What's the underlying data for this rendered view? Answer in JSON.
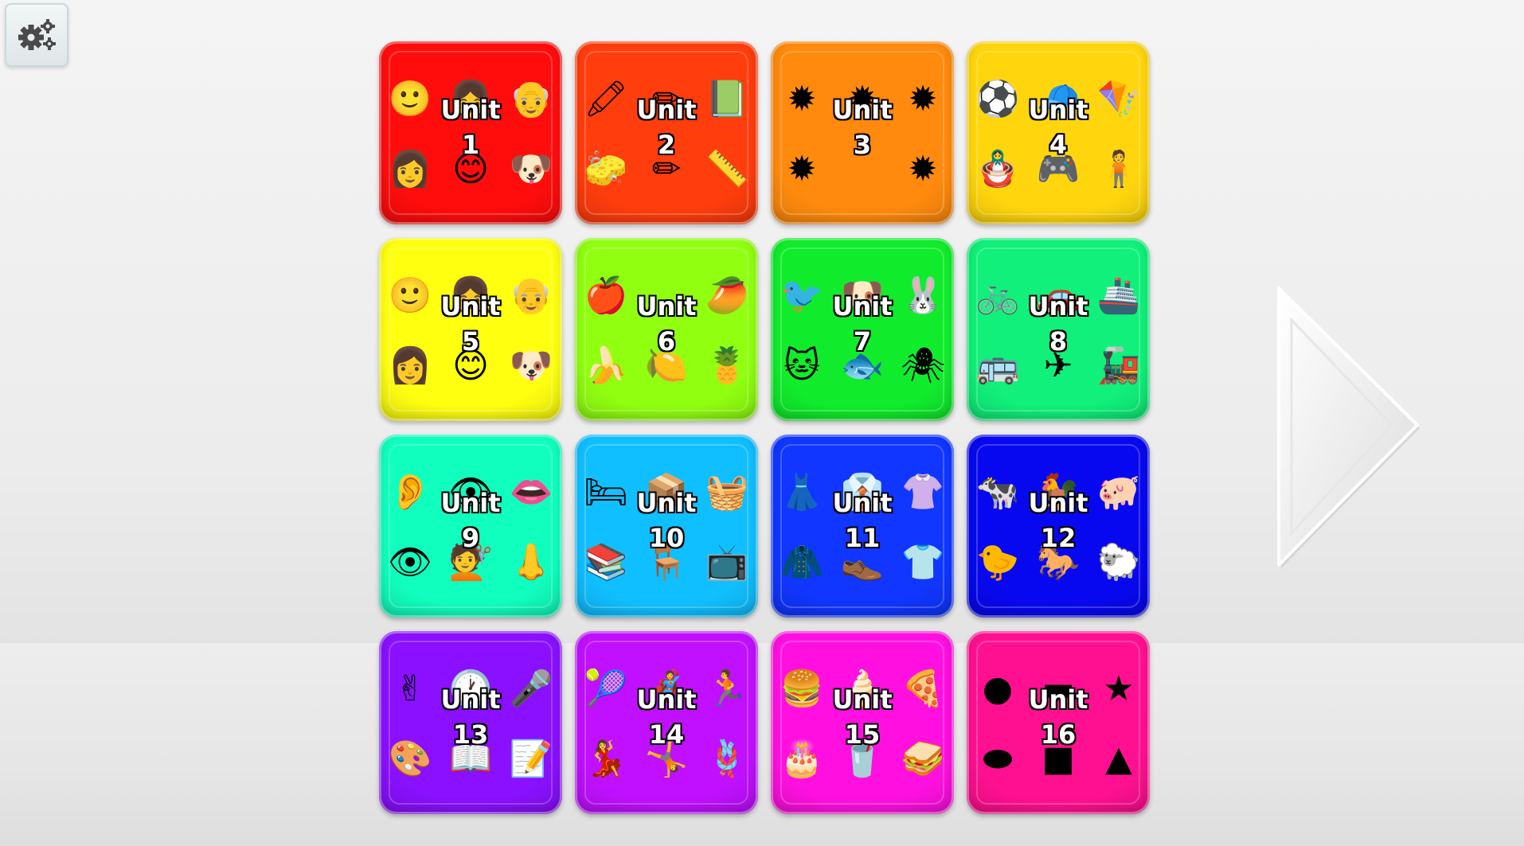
{
  "settings": {
    "icon": "gear-icon"
  },
  "next": {
    "icon": "next-arrow-icon"
  },
  "units": [
    {
      "title": "Unit",
      "number": "1",
      "color": "#ff0d0d",
      "icons": [
        "🙂",
        "👧",
        "👴",
        "👩",
        "😊",
        "🐶"
      ]
    },
    {
      "title": "Unit",
      "number": "2",
      "color": "#ff3d0d",
      "icons": [
        "🖍",
        "✏",
        "📗",
        "🧽",
        "✏",
        "📏"
      ]
    },
    {
      "title": "Unit",
      "number": "3",
      "color": "#ff8a0d",
      "icons": [
        "✹",
        "✹",
        "✹",
        "✹",
        "",
        "✹"
      ]
    },
    {
      "title": "Unit",
      "number": "4",
      "color": "#ffd60d",
      "icons": [
        "⚽",
        "🧢",
        "🪁",
        "🪆",
        "🎮",
        "🧍"
      ]
    },
    {
      "title": "Unit",
      "number": "5",
      "color": "#ffff10",
      "icons": [
        "🙂",
        "👧",
        "👴",
        "👩",
        "😊",
        "🐶"
      ]
    },
    {
      "title": "Unit",
      "number": "6",
      "color": "#90ff10",
      "icons": [
        "🍎",
        "",
        "🥭",
        "🍌",
        "🍋",
        "🍍"
      ]
    },
    {
      "title": "Unit",
      "number": "7",
      "color": "#10ec2c",
      "icons": [
        "🐦",
        "🐶",
        "🐰",
        "🐱",
        "🐟",
        "🕷"
      ]
    },
    {
      "title": "Unit",
      "number": "8",
      "color": "#10f07a",
      "icons": [
        "🚲",
        "🚗",
        "🚢",
        "🚌",
        "✈",
        "🚂"
      ]
    },
    {
      "title": "Unit",
      "number": "9",
      "color": "#10ffbe",
      "icons": [
        "👂",
        "👁",
        "👄",
        "👁",
        "💇",
        "👃"
      ]
    },
    {
      "title": "Unit",
      "number": "10",
      "color": "#10bfff",
      "icons": [
        "🛏",
        "📦",
        "🧺",
        "📚",
        "🪑",
        "📺"
      ]
    },
    {
      "title": "Unit",
      "number": "11",
      "color": "#1036ff",
      "icons": [
        "👗",
        "👔",
        "👚",
        "🧥",
        "👞",
        "👕"
      ]
    },
    {
      "title": "Unit",
      "number": "12",
      "color": "#0808f0",
      "icons": [
        "🐄",
        "🐓",
        "🐖",
        "🐤",
        "🐎",
        "🐑"
      ]
    },
    {
      "title": "Unit",
      "number": "13",
      "color": "#8a10ff",
      "icons": [
        "✌",
        "🕐",
        "🎤",
        "🎨",
        "📖",
        "📝"
      ]
    },
    {
      "title": "Unit",
      "number": "14",
      "color": "#c010ff",
      "icons": [
        "🎾",
        "🦸",
        "🏃",
        "💃",
        "🤸",
        "🪢"
      ]
    },
    {
      "title": "Unit",
      "number": "15",
      "color": "#ff10e0",
      "icons": [
        "🍔",
        "🍦",
        "🍕",
        "🎂",
        "🥤",
        "🥪"
      ]
    },
    {
      "title": "Unit",
      "number": "16",
      "color": "#ff1090",
      "icons": [
        "●",
        "▬",
        "★",
        "⬬",
        "■",
        "▲"
      ]
    }
  ]
}
